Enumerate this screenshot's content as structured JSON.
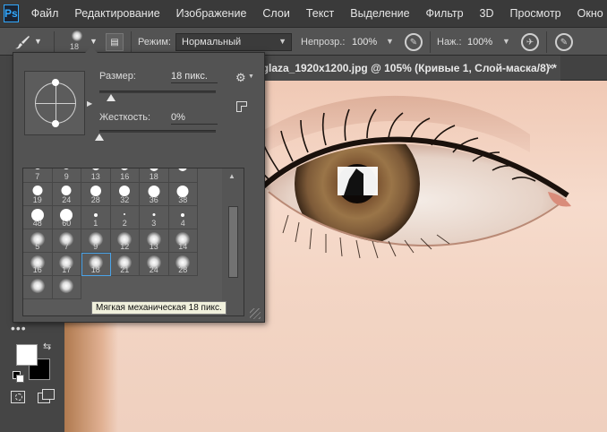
{
  "app": {
    "logo": "Ps",
    "menu": [
      "Файл",
      "Редактирование",
      "Изображение",
      "Слои",
      "Текст",
      "Выделение",
      "Фильтр",
      "3D",
      "Просмотр",
      "Окно"
    ]
  },
  "options_bar": {
    "tool_icon": "brush-icon",
    "brush_size_display": "18",
    "mode_label": "Режим:",
    "mode_value": "Нормальный",
    "opacity_label": "Непрозр.:",
    "opacity_value": "100%",
    "flow_label": "Наж.:",
    "flow_value": "100%"
  },
  "document_tab": {
    "title": "_glaza_1920x1200.jpg @ 105% (Кривые 1, Слой-маска/8) *",
    "close": "×"
  },
  "brush_picker": {
    "size_label": "Размер:",
    "size_value": "18 пикс.",
    "size_level": 0.04,
    "hardness_label": "Жесткость:",
    "hardness_value": "0%",
    "hardness_level": 0.0,
    "presets": [
      {
        "label": "7",
        "kind": "hard"
      },
      {
        "label": "9",
        "kind": "hard"
      },
      {
        "label": "13",
        "kind": "hard"
      },
      {
        "label": "16",
        "kind": "hard"
      },
      {
        "label": "18",
        "kind": "hard"
      },
      {
        "label": "",
        "kind": "hard"
      },
      {
        "label": "19",
        "kind": "hard"
      },
      {
        "label": "24",
        "kind": "hard"
      },
      {
        "label": "28",
        "kind": "hard"
      },
      {
        "label": "32",
        "kind": "hard"
      },
      {
        "label": "36",
        "kind": "hard"
      },
      {
        "label": "38",
        "kind": "hard"
      },
      {
        "label": "48",
        "kind": "hard"
      },
      {
        "label": "60",
        "kind": "hard"
      },
      {
        "label": "1",
        "kind": "dot"
      },
      {
        "label": "2",
        "kind": "dot"
      },
      {
        "label": "3",
        "kind": "dot"
      },
      {
        "label": "4",
        "kind": "dot"
      },
      {
        "label": "5",
        "kind": "soft"
      },
      {
        "label": "7",
        "kind": "soft"
      },
      {
        "label": "9",
        "kind": "soft"
      },
      {
        "label": "12",
        "kind": "soft"
      },
      {
        "label": "13",
        "kind": "soft"
      },
      {
        "label": "14",
        "kind": "soft"
      },
      {
        "label": "16",
        "kind": "soft"
      },
      {
        "label": "17",
        "kind": "soft"
      },
      {
        "label": "18",
        "kind": "soft",
        "selected": true
      },
      {
        "label": "21",
        "kind": "soft"
      },
      {
        "label": "24",
        "kind": "soft"
      },
      {
        "label": "28",
        "kind": "soft"
      },
      {
        "label": "",
        "kind": "soft"
      },
      {
        "label": "",
        "kind": "soft"
      }
    ],
    "tooltip": "Мягкая механическая 18 пикс."
  },
  "colors": {
    "foreground": "#ffffff",
    "background": "#000000",
    "accent": "#4aa3e8"
  }
}
